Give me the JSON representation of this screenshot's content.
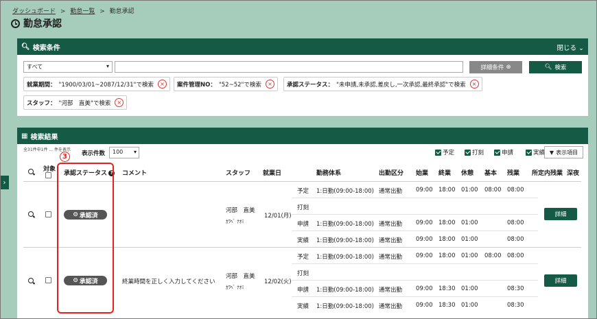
{
  "breadcrumb": {
    "items": [
      "ダッシュボード",
      "勤怠一覧",
      "勤怠承認"
    ],
    "sep": ">"
  },
  "page": {
    "title": "勤怠承認"
  },
  "search": {
    "header": "検索条件",
    "close_label": "閉じる",
    "select_value": "すべて",
    "detail_button": "詳細条件",
    "search_button": "検索",
    "chips": [
      {
        "label": "就業期間：",
        "value": "\"1900/03/01~2087/12/31\"で検索"
      },
      {
        "label": "案件管理NO：",
        "value": "\"52~52\"で検索"
      },
      {
        "label": "承認ステータス：",
        "value": "\"未申請,未承認,差戻し,一次承認,最終承認\"で検索"
      },
      {
        "label": "スタッフ：",
        "value": "\"河部　直美\"で検索"
      }
    ]
  },
  "results": {
    "header": "検索結果",
    "count_text": "全31件中1件 ... 件を表示",
    "display_count_label": "表示件数",
    "display_count_value": "100",
    "filters": [
      "予定",
      "打刻",
      "申請",
      "実績"
    ],
    "columns_button": "表示項目",
    "columns": {
      "target": "対象",
      "status": "承認ステータス",
      "comment": "コメント",
      "staff": "スタッフ",
      "date": "就業日",
      "shift": "勤務体系",
      "attendance": "出勤区分",
      "start": "始業",
      "end": "終業",
      "break": "休憩",
      "base": "基本",
      "overtime": "残業",
      "scheduled_ot": "所定内残業",
      "late_night": "深夜"
    },
    "rows": [
      {
        "status": "承認済",
        "comment": "",
        "staff_name": "河部　直美",
        "staff_kana": "ｶﾜﾍﾞ ﾅｵﾐ",
        "date": "12/01(月)",
        "detail": "詳細",
        "lines": [
          {
            "type": "予定",
            "shift": "1:日勤(09:00-18:00)",
            "attendance": "通常出勤",
            "start": "09:00",
            "end": "18:00",
            "break": "01:00",
            "base": "08:00",
            "overtime": "08:00"
          },
          {
            "type": "打刻",
            "shift": "",
            "attendance": "",
            "start": "",
            "end": "",
            "break": "",
            "base": "",
            "overtime": ""
          },
          {
            "type": "申請",
            "shift": "1:日勤(09:00-18:00)",
            "attendance": "通常出勤",
            "start": "09:00",
            "end": "18:00",
            "break": "01:00",
            "base": "",
            "overtime": "08:00"
          },
          {
            "type": "実績",
            "shift": "1:日勤(09:00-18:00)",
            "attendance": "通常出勤",
            "start": "09:00",
            "end": "18:00",
            "break": "01:00",
            "base": "",
            "overtime": "08:00"
          }
        ]
      },
      {
        "status": "承認済",
        "comment": "終業時間を正しく入力してください",
        "staff_name": "河部　直美",
        "staff_kana": "ｶﾜﾍﾞ ﾅｵﾐ",
        "date": "12/02(火)",
        "detail": "詳細",
        "lines": [
          {
            "type": "予定",
            "shift": "1:日勤(09:00-18:00)",
            "attendance": "通常出勤",
            "start": "09:00",
            "end": "18:00",
            "break": "01:00",
            "base": "08:00",
            "overtime": "08:00"
          },
          {
            "type": "打刻",
            "shift": "",
            "attendance": "",
            "start": "",
            "end": "",
            "break": "",
            "base": "",
            "overtime": ""
          },
          {
            "type": "申請",
            "shift": "1:日勤(09:00-18:00)",
            "attendance": "通常出勤",
            "start": "09:00",
            "end": "18:30",
            "break": "01:00",
            "base": "",
            "overtime": "08:30"
          },
          {
            "type": "実績",
            "shift": "1:日勤(09:00-18:00)",
            "attendance": "通常出勤",
            "start": "09:00",
            "end": "18:30",
            "break": "01:00",
            "base": "",
            "overtime": "08:30"
          }
        ]
      }
    ]
  },
  "annotation": {
    "callout_number": "3"
  }
}
